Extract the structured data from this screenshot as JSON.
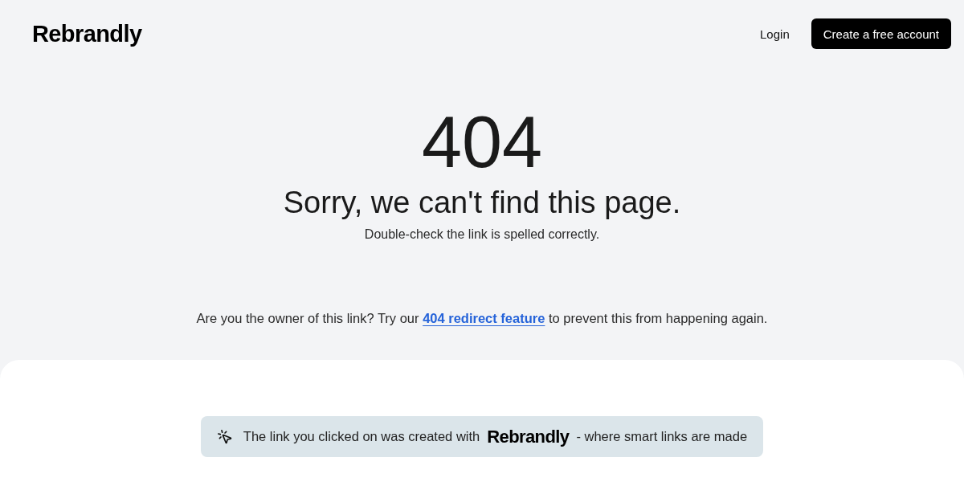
{
  "header": {
    "logo": "Rebrandly",
    "nav": [
      {
        "kind": "link",
        "label": "Login"
      },
      {
        "kind": "button",
        "label": "Create a free account"
      }
    ]
  },
  "error": {
    "code": "404",
    "title": "Sorry, we can't find this page.",
    "subtitle": "Double-check the link is spelled correctly."
  },
  "owner_prompt": {
    "before": "Are you the owner of this link? Try our",
    "link": "404 redirect feature",
    "after": "to prevent this from happening again."
  },
  "banner": {
    "before": "The link you clicked on was created with",
    "logo": "Rebrandly",
    "after": "- where smart links are made"
  }
}
